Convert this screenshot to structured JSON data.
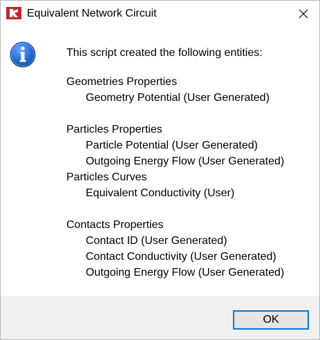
{
  "window": {
    "title": "Equivalent Network Circuit",
    "app_icon": "app-logo-icon",
    "close_icon": "close-icon"
  },
  "message": {
    "icon": "information-icon",
    "intro": "This script created the following entities:",
    "groups": [
      {
        "heading": "Geometries Properties",
        "items": [
          "Geometry Potential (User Generated)"
        ]
      },
      {
        "heading": "Particles Properties",
        "items": [
          "Particle Potential (User Generated)",
          "Outgoing Energy Flow (User Generated)"
        ]
      },
      {
        "heading": "Particles Curves",
        "items": [
          "Equivalent Conductivity (User)"
        ]
      },
      {
        "heading": "Contacts Properties",
        "items": [
          "Contact ID (User Generated)",
          "Contact Conductivity (User Generated)",
          "Outgoing Energy Flow (User Generated)"
        ]
      }
    ]
  },
  "footer": {
    "ok_label": "OK"
  },
  "colors": {
    "accent": "#0078d7",
    "footer_bg": "#f0f0f0",
    "logo_red": "#c0262d",
    "info_blue": "#1f5fbf"
  }
}
